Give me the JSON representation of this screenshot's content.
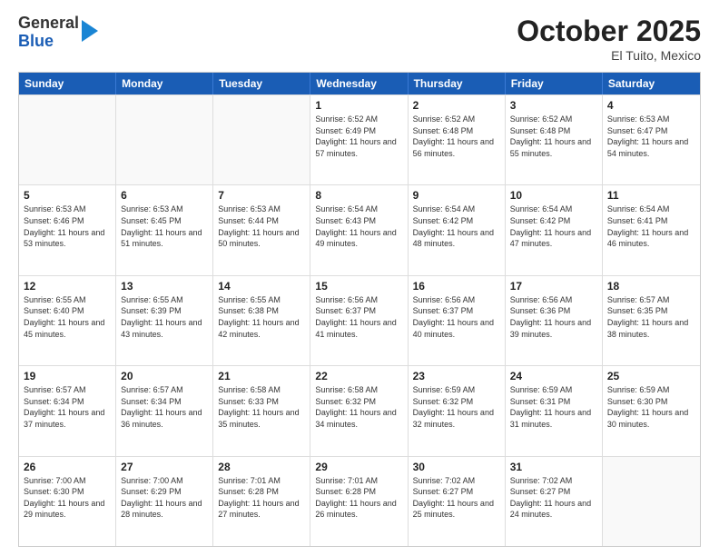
{
  "header": {
    "logo": {
      "general": "General",
      "blue": "Blue"
    },
    "title": "October 2025",
    "location": "El Tuito, Mexico"
  },
  "calendar": {
    "days_of_week": [
      "Sunday",
      "Monday",
      "Tuesday",
      "Wednesday",
      "Thursday",
      "Friday",
      "Saturday"
    ],
    "weeks": [
      [
        {
          "day": "",
          "sunrise": "",
          "sunset": "",
          "daylight": "",
          "empty": true
        },
        {
          "day": "",
          "sunrise": "",
          "sunset": "",
          "daylight": "",
          "empty": true
        },
        {
          "day": "",
          "sunrise": "",
          "sunset": "",
          "daylight": "",
          "empty": true
        },
        {
          "day": "1",
          "sunrise": "Sunrise: 6:52 AM",
          "sunset": "Sunset: 6:49 PM",
          "daylight": "Daylight: 11 hours and 57 minutes.",
          "empty": false
        },
        {
          "day": "2",
          "sunrise": "Sunrise: 6:52 AM",
          "sunset": "Sunset: 6:48 PM",
          "daylight": "Daylight: 11 hours and 56 minutes.",
          "empty": false
        },
        {
          "day": "3",
          "sunrise": "Sunrise: 6:52 AM",
          "sunset": "Sunset: 6:48 PM",
          "daylight": "Daylight: 11 hours and 55 minutes.",
          "empty": false
        },
        {
          "day": "4",
          "sunrise": "Sunrise: 6:53 AM",
          "sunset": "Sunset: 6:47 PM",
          "daylight": "Daylight: 11 hours and 54 minutes.",
          "empty": false
        }
      ],
      [
        {
          "day": "5",
          "sunrise": "Sunrise: 6:53 AM",
          "sunset": "Sunset: 6:46 PM",
          "daylight": "Daylight: 11 hours and 53 minutes.",
          "empty": false
        },
        {
          "day": "6",
          "sunrise": "Sunrise: 6:53 AM",
          "sunset": "Sunset: 6:45 PM",
          "daylight": "Daylight: 11 hours and 51 minutes.",
          "empty": false
        },
        {
          "day": "7",
          "sunrise": "Sunrise: 6:53 AM",
          "sunset": "Sunset: 6:44 PM",
          "daylight": "Daylight: 11 hours and 50 minutes.",
          "empty": false
        },
        {
          "day": "8",
          "sunrise": "Sunrise: 6:54 AM",
          "sunset": "Sunset: 6:43 PM",
          "daylight": "Daylight: 11 hours and 49 minutes.",
          "empty": false
        },
        {
          "day": "9",
          "sunrise": "Sunrise: 6:54 AM",
          "sunset": "Sunset: 6:42 PM",
          "daylight": "Daylight: 11 hours and 48 minutes.",
          "empty": false
        },
        {
          "day": "10",
          "sunrise": "Sunrise: 6:54 AM",
          "sunset": "Sunset: 6:42 PM",
          "daylight": "Daylight: 11 hours and 47 minutes.",
          "empty": false
        },
        {
          "day": "11",
          "sunrise": "Sunrise: 6:54 AM",
          "sunset": "Sunset: 6:41 PM",
          "daylight": "Daylight: 11 hours and 46 minutes.",
          "empty": false
        }
      ],
      [
        {
          "day": "12",
          "sunrise": "Sunrise: 6:55 AM",
          "sunset": "Sunset: 6:40 PM",
          "daylight": "Daylight: 11 hours and 45 minutes.",
          "empty": false
        },
        {
          "day": "13",
          "sunrise": "Sunrise: 6:55 AM",
          "sunset": "Sunset: 6:39 PM",
          "daylight": "Daylight: 11 hours and 43 minutes.",
          "empty": false
        },
        {
          "day": "14",
          "sunrise": "Sunrise: 6:55 AM",
          "sunset": "Sunset: 6:38 PM",
          "daylight": "Daylight: 11 hours and 42 minutes.",
          "empty": false
        },
        {
          "day": "15",
          "sunrise": "Sunrise: 6:56 AM",
          "sunset": "Sunset: 6:37 PM",
          "daylight": "Daylight: 11 hours and 41 minutes.",
          "empty": false
        },
        {
          "day": "16",
          "sunrise": "Sunrise: 6:56 AM",
          "sunset": "Sunset: 6:37 PM",
          "daylight": "Daylight: 11 hours and 40 minutes.",
          "empty": false
        },
        {
          "day": "17",
          "sunrise": "Sunrise: 6:56 AM",
          "sunset": "Sunset: 6:36 PM",
          "daylight": "Daylight: 11 hours and 39 minutes.",
          "empty": false
        },
        {
          "day": "18",
          "sunrise": "Sunrise: 6:57 AM",
          "sunset": "Sunset: 6:35 PM",
          "daylight": "Daylight: 11 hours and 38 minutes.",
          "empty": false
        }
      ],
      [
        {
          "day": "19",
          "sunrise": "Sunrise: 6:57 AM",
          "sunset": "Sunset: 6:34 PM",
          "daylight": "Daylight: 11 hours and 37 minutes.",
          "empty": false
        },
        {
          "day": "20",
          "sunrise": "Sunrise: 6:57 AM",
          "sunset": "Sunset: 6:34 PM",
          "daylight": "Daylight: 11 hours and 36 minutes.",
          "empty": false
        },
        {
          "day": "21",
          "sunrise": "Sunrise: 6:58 AM",
          "sunset": "Sunset: 6:33 PM",
          "daylight": "Daylight: 11 hours and 35 minutes.",
          "empty": false
        },
        {
          "day": "22",
          "sunrise": "Sunrise: 6:58 AM",
          "sunset": "Sunset: 6:32 PM",
          "daylight": "Daylight: 11 hours and 34 minutes.",
          "empty": false
        },
        {
          "day": "23",
          "sunrise": "Sunrise: 6:59 AM",
          "sunset": "Sunset: 6:32 PM",
          "daylight": "Daylight: 11 hours and 32 minutes.",
          "empty": false
        },
        {
          "day": "24",
          "sunrise": "Sunrise: 6:59 AM",
          "sunset": "Sunset: 6:31 PM",
          "daylight": "Daylight: 11 hours and 31 minutes.",
          "empty": false
        },
        {
          "day": "25",
          "sunrise": "Sunrise: 6:59 AM",
          "sunset": "Sunset: 6:30 PM",
          "daylight": "Daylight: 11 hours and 30 minutes.",
          "empty": false
        }
      ],
      [
        {
          "day": "26",
          "sunrise": "Sunrise: 7:00 AM",
          "sunset": "Sunset: 6:30 PM",
          "daylight": "Daylight: 11 hours and 29 minutes.",
          "empty": false
        },
        {
          "day": "27",
          "sunrise": "Sunrise: 7:00 AM",
          "sunset": "Sunset: 6:29 PM",
          "daylight": "Daylight: 11 hours and 28 minutes.",
          "empty": false
        },
        {
          "day": "28",
          "sunrise": "Sunrise: 7:01 AM",
          "sunset": "Sunset: 6:28 PM",
          "daylight": "Daylight: 11 hours and 27 minutes.",
          "empty": false
        },
        {
          "day": "29",
          "sunrise": "Sunrise: 7:01 AM",
          "sunset": "Sunset: 6:28 PM",
          "daylight": "Daylight: 11 hours and 26 minutes.",
          "empty": false
        },
        {
          "day": "30",
          "sunrise": "Sunrise: 7:02 AM",
          "sunset": "Sunset: 6:27 PM",
          "daylight": "Daylight: 11 hours and 25 minutes.",
          "empty": false
        },
        {
          "day": "31",
          "sunrise": "Sunrise: 7:02 AM",
          "sunset": "Sunset: 6:27 PM",
          "daylight": "Daylight: 11 hours and 24 minutes.",
          "empty": false
        },
        {
          "day": "",
          "sunrise": "",
          "sunset": "",
          "daylight": "",
          "empty": true
        }
      ]
    ]
  }
}
